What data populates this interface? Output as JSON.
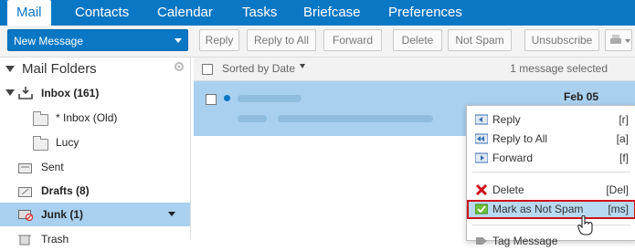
{
  "tabs": [
    "Mail",
    "Contacts",
    "Calendar",
    "Tasks",
    "Briefcase",
    "Preferences"
  ],
  "toolbar": {
    "new_message": "New Message",
    "reply": "Reply",
    "reply_all": "Reply to All",
    "forward": "Forward",
    "delete": "Delete",
    "not_spam": "Not Spam",
    "unsubscribe": "Unsubscribe"
  },
  "sidebar": {
    "header": "Mail Folders",
    "folders": [
      {
        "label": "Inbox (161)",
        "bold": true
      },
      {
        "label": "* Inbox (Old)",
        "bold": false
      },
      {
        "label": "Lucy",
        "bold": false
      },
      {
        "label": "Sent",
        "bold": false
      },
      {
        "label": "Drafts (8)",
        "bold": true
      },
      {
        "label": "Junk (1)",
        "bold": true
      },
      {
        "label": "Trash",
        "bold": false
      }
    ]
  },
  "list": {
    "sort_label": "Sorted by Date",
    "selection_status": "1 message selected",
    "message_date": "Feb 05"
  },
  "context_menu": {
    "items": [
      {
        "label": "Reply",
        "shortcut": "[r]"
      },
      {
        "label": "Reply to All",
        "shortcut": "[a]"
      },
      {
        "label": "Forward",
        "shortcut": "[f]"
      },
      {
        "label": "Delete",
        "shortcut": "[Del]"
      },
      {
        "label": "Mark as Not Spam",
        "shortcut": "[ms]"
      },
      {
        "label": "Tag Message",
        "shortcut": ""
      }
    ]
  },
  "colors": {
    "accent": "#0a77c5",
    "selection": "#a9d0ef",
    "highlight_border": "#d0111b"
  }
}
